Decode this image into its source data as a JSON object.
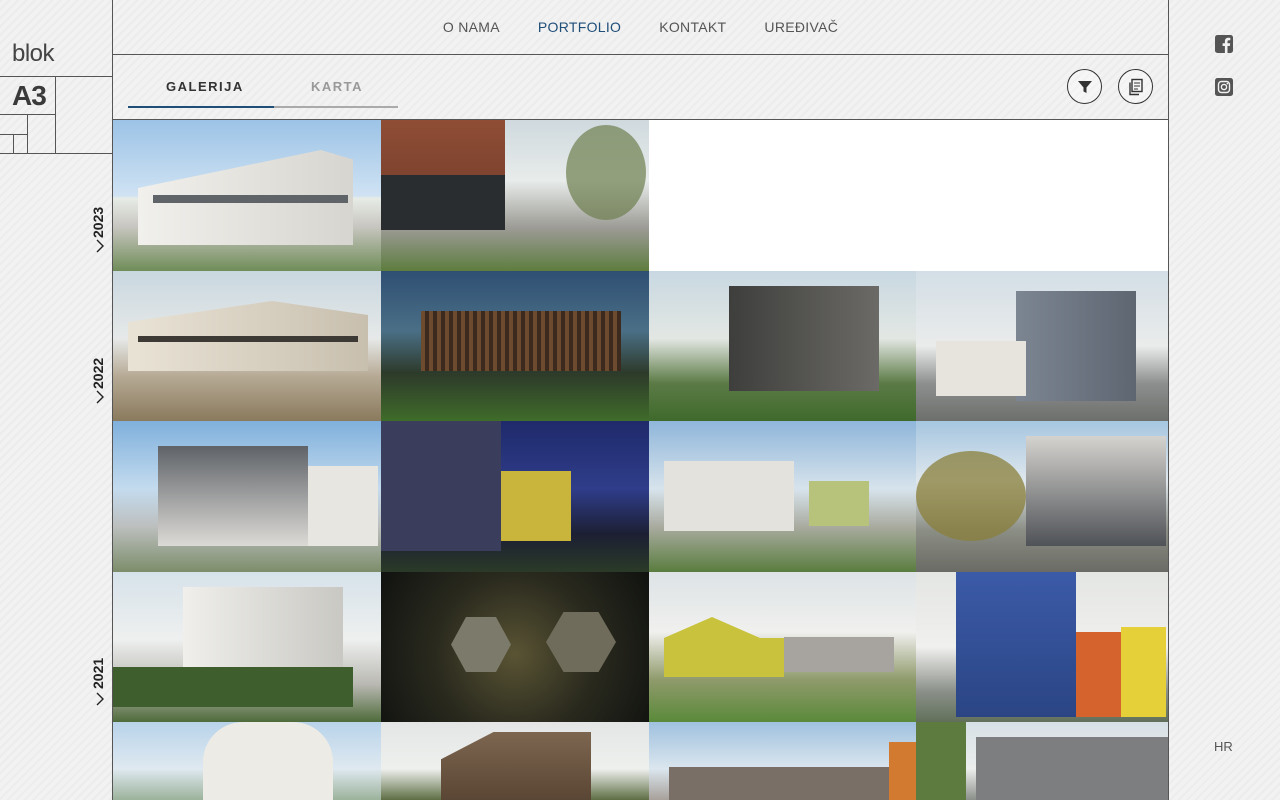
{
  "brand": {
    "line1": "blok",
    "line2": "A3"
  },
  "nav": {
    "items": [
      {
        "label": "O NAMA"
      },
      {
        "label": "PORTFOLIO"
      },
      {
        "label": "KONTAKT"
      },
      {
        "label": "UREĐIVAČ"
      }
    ],
    "active": "PORTFOLIO",
    "active_color": "#1f4e79"
  },
  "tabs": {
    "gallery": "GALERIJA",
    "map": "KARTA",
    "active_color": "#1f4e79"
  },
  "toolbar": {
    "filter_icon": "filter-icon",
    "documents_icon": "documents-icon"
  },
  "timeline": {
    "years": [
      "2023",
      "2022",
      "2021"
    ]
  },
  "social": {
    "facebook_icon": "facebook-icon",
    "instagram_icon": "instagram-icon"
  },
  "language": "HR",
  "gallery": {
    "tiles": [
      {
        "scene": "terraced-apartment-day"
      },
      {
        "scene": "brick-courtyard"
      },
      {
        "scene": "white-villa-dusk"
      },
      {
        "scene": "wooden-fins-night"
      },
      {
        "scene": "dark-house-garden"
      },
      {
        "scene": "grey-townhouse"
      },
      {
        "scene": "office-street"
      },
      {
        "scene": "blue-night-building"
      },
      {
        "scene": "residential-street"
      },
      {
        "scene": "pergola-house"
      },
      {
        "scene": "grey-house-garden"
      },
      {
        "scene": "park-night-aerial"
      },
      {
        "scene": "yellow-kindergarten"
      },
      {
        "scene": "blue-kindergarten"
      },
      {
        "scene": "white-arch-pavilion"
      },
      {
        "scene": "wooden-gable-house"
      },
      {
        "scene": "orange-long-building"
      },
      {
        "scene": "grey-building-trees"
      }
    ]
  }
}
